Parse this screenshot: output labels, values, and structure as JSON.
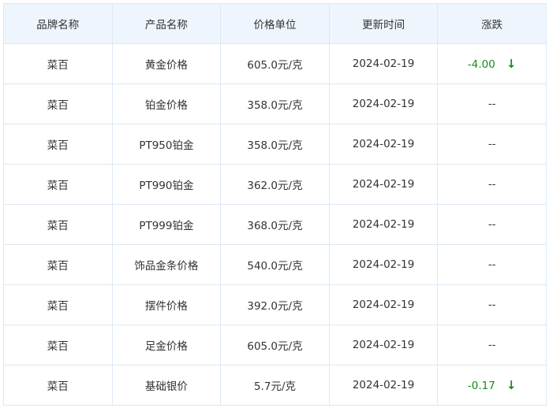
{
  "table": {
    "headers": [
      "品牌名称",
      "产品名称",
      "价格单位",
      "更新时间",
      "涨跌"
    ],
    "rows": [
      {
        "brand": "菜百",
        "product": "黄金价格",
        "price": "605.0元/克",
        "date": "2024-02-19",
        "change": "-4.00",
        "direction": "down"
      },
      {
        "brand": "菜百",
        "product": "铂金价格",
        "price": "358.0元/克",
        "date": "2024-02-19",
        "change": "--",
        "direction": "none"
      },
      {
        "brand": "菜百",
        "product": "PT950铂金",
        "price": "358.0元/克",
        "date": "2024-02-19",
        "change": "--",
        "direction": "none"
      },
      {
        "brand": "菜百",
        "product": "PT990铂金",
        "price": "362.0元/克",
        "date": "2024-02-19",
        "change": "--",
        "direction": "none"
      },
      {
        "brand": "菜百",
        "product": "PT999铂金",
        "price": "368.0元/克",
        "date": "2024-02-19",
        "change": "--",
        "direction": "none"
      },
      {
        "brand": "菜百",
        "product": "饰品金条价格",
        "price": "540.0元/克",
        "date": "2024-02-19",
        "change": "--",
        "direction": "none"
      },
      {
        "brand": "菜百",
        "product": "摆件价格",
        "price": "392.0元/克",
        "date": "2024-02-19",
        "change": "--",
        "direction": "none"
      },
      {
        "brand": "菜百",
        "product": "足金价格",
        "price": "605.0元/克",
        "date": "2024-02-19",
        "change": "--",
        "direction": "none"
      },
      {
        "brand": "菜百",
        "product": "基础银价",
        "price": "5.7元/克",
        "date": "2024-02-19",
        "change": "-0.17",
        "direction": "down"
      }
    ]
  },
  "icons": {
    "down_arrow": "↓",
    "down_arrow_name": "arrow-down-icon"
  },
  "colors": {
    "header_bg": "#eef5fc",
    "border": "#dde8f3",
    "down": "#1a8a1a",
    "text": "#333333"
  }
}
